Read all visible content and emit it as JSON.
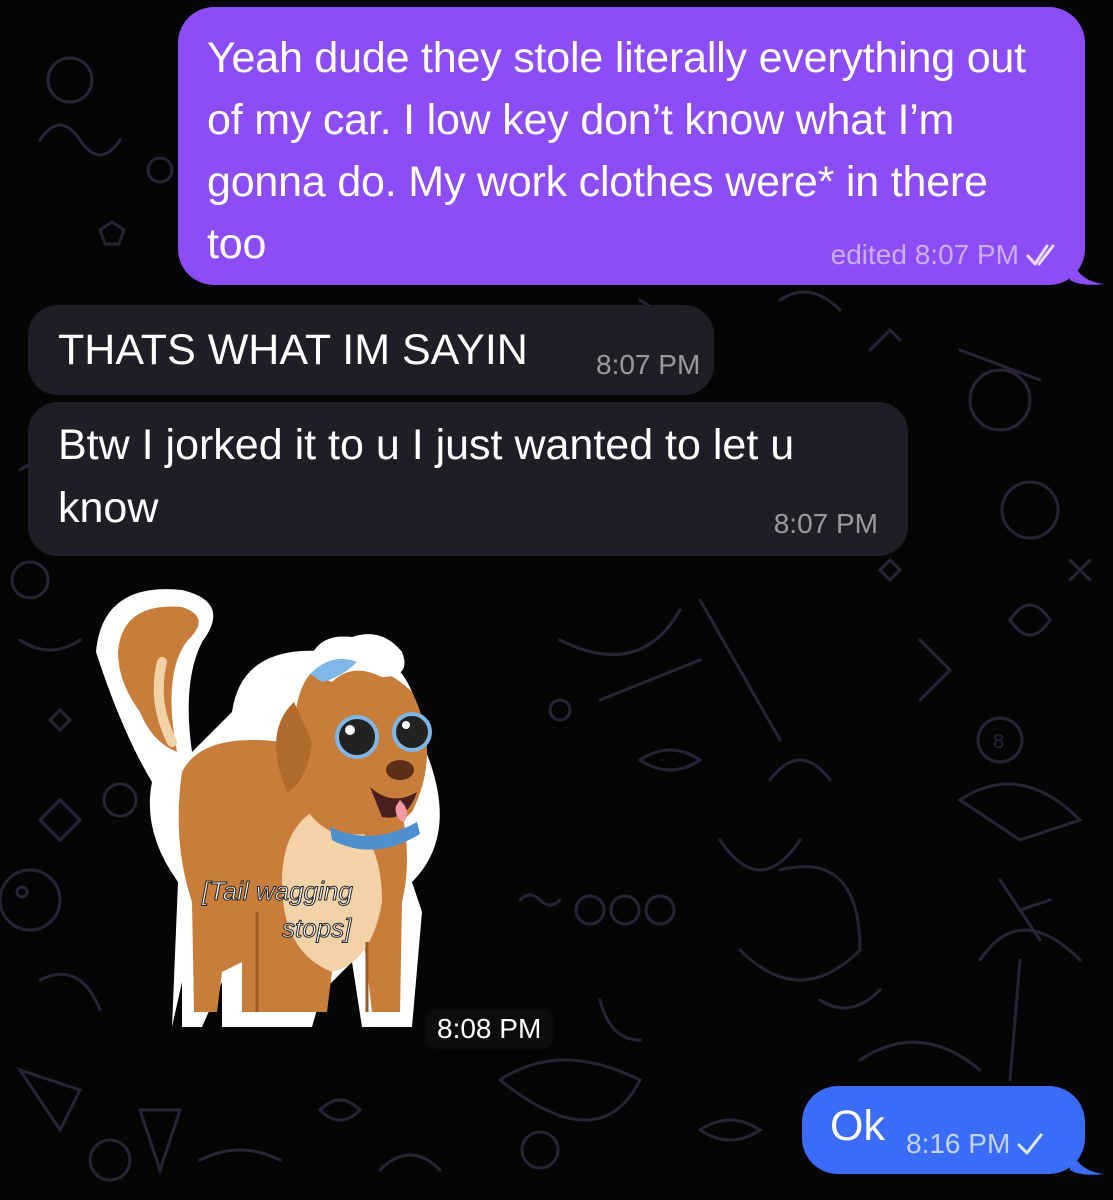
{
  "colors": {
    "outgoing_bubble": "#8c4cf6",
    "outgoing_bubble_last": "#3a6cf7",
    "incoming_bubble": "#211d27",
    "background": "#050506"
  },
  "messages": [
    {
      "direction": "outgoing",
      "text": "Yeah dude they stole literally everything out of my car. I low key don’t know what I’m gonna do. My work clothes were* in there too",
      "meta": "edited 8:07 PM",
      "status_icon": "double-check-icon"
    },
    {
      "direction": "incoming",
      "text": "THATS WHAT IM SAYIN",
      "meta": "8:07 PM"
    },
    {
      "direction": "incoming",
      "text": "Btw I jorked it to u I just wanted to let u know",
      "meta": "8:07 PM"
    },
    {
      "direction": "incoming",
      "type": "sticker",
      "sticker_caption": "[Tail wagging stops]",
      "sticker_caption_line1": "[Tail wagging",
      "sticker_caption_line2": "stops]",
      "meta": "8:08 PM"
    },
    {
      "direction": "outgoing",
      "text": "Ok",
      "meta": "8:16 PM",
      "status_icon": "single-check-icon"
    }
  ]
}
